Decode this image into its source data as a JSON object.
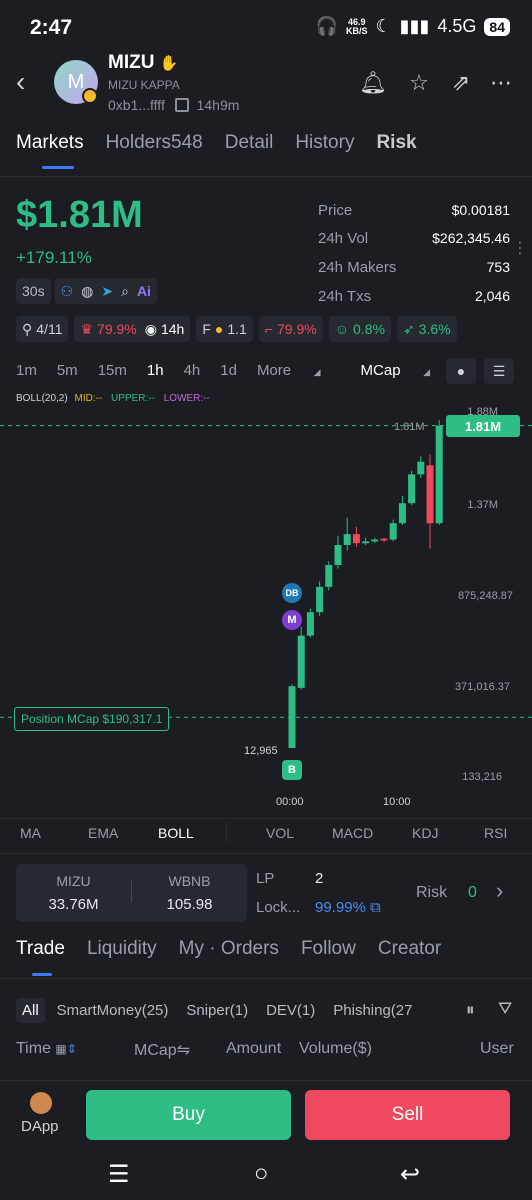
{
  "status_bar": {
    "time": "2:47",
    "net_speed_value": "46.9",
    "net_speed_unit": "KB/S",
    "signal": "4.5G",
    "battery": "84"
  },
  "token": {
    "avatar_letter": "M",
    "name": "MIZU",
    "fullname": "MIZU KAPPA",
    "address": "0xb1...ffff",
    "age": "14h9m"
  },
  "tabs": [
    "Markets",
    "Holders548",
    "Detail",
    "History",
    "Risk"
  ],
  "market": {
    "mcap": "$1.81M",
    "change": "+179.11%",
    "refresh": "30s",
    "stats": [
      {
        "label": "Price",
        "value": "$0.00181"
      },
      {
        "label": "24h Vol",
        "value": "$262,345.46"
      },
      {
        "label": "24h Makers",
        "value": "753"
      },
      {
        "label": "24h Txs",
        "value": "2,046"
      }
    ],
    "badges": {
      "holders_ratio": "4/11",
      "top10": "79.9%",
      "age": "14h",
      "f_label": "F",
      "f_value": "1.1",
      "sniper": "79.9%",
      "dev": "0.8%",
      "insider": "3.6%"
    }
  },
  "intervals": [
    "1m",
    "5m",
    "15m",
    "1h",
    "4h",
    "1d",
    "More",
    "MCap"
  ],
  "active_interval": "1h",
  "legend": {
    "boll": "BOLL(20,2)",
    "mid": "MID:--",
    "upper": "UPPER:--",
    "lower": "LOWER:--"
  },
  "chart_data": {
    "type": "candlestick",
    "y_axis_labels": [
      "1.88M",
      "1.37M",
      "875,248.87",
      "371,016.37",
      "133,216"
    ],
    "x_axis_labels": [
      "00:00",
      "10:00"
    ],
    "current_label": "1.81M",
    "current_tag": "1.81M",
    "low_label": "12,965",
    "position_label": "Position MCap $190,317.1",
    "markers": [
      "DB",
      "M",
      "B"
    ],
    "colors": {
      "up": "#2ebd85",
      "down": "#f0485e"
    },
    "candles": [
      {
        "open": 12965,
        "close": 370000,
        "low": 12965,
        "high": 380000
      },
      {
        "open": 360000,
        "close": 650000,
        "low": 350000,
        "high": 700000
      },
      {
        "open": 650000,
        "close": 780000,
        "low": 640000,
        "high": 800000
      },
      {
        "open": 780000,
        "close": 920000,
        "low": 760000,
        "high": 950000
      },
      {
        "open": 920000,
        "close": 1040000,
        "low": 900000,
        "high": 1060000
      },
      {
        "open": 1040000,
        "close": 1150000,
        "low": 1020000,
        "high": 1200000
      },
      {
        "open": 1150000,
        "close": 1210000,
        "low": 1120000,
        "high": 1300000
      },
      {
        "open": 1210000,
        "close": 1160000,
        "low": 1140000,
        "high": 1250000
      },
      {
        "open": 1160000,
        "close": 1170000,
        "low": 1150000,
        "high": 1190000
      },
      {
        "open": 1170000,
        "close": 1180000,
        "low": 1160000,
        "high": 1190000
      },
      {
        "open": 1185000,
        "close": 1175000,
        "low": 1165000,
        "high": 1190000
      },
      {
        "open": 1180000,
        "close": 1270000,
        "low": 1170000,
        "high": 1290000
      },
      {
        "open": 1270000,
        "close": 1380000,
        "low": 1260000,
        "high": 1420000
      },
      {
        "open": 1380000,
        "close": 1540000,
        "low": 1370000,
        "high": 1560000
      },
      {
        "open": 1540000,
        "close": 1610000,
        "low": 1520000,
        "high": 1640000
      },
      {
        "open": 1590000,
        "close": 1270000,
        "low": 1130000,
        "high": 1650000
      },
      {
        "open": 1270000,
        "close": 1810000,
        "low": 1260000,
        "high": 1840000
      }
    ]
  },
  "indicators": [
    "MA",
    "EMA",
    "BOLL",
    "VOL",
    "MACD",
    "KDJ",
    "RSI"
  ],
  "active_indicator": "BOLL",
  "pool": {
    "token_label": "MIZU",
    "token_value": "33.76M",
    "pair_label": "WBNB",
    "pair_value": "105.98",
    "lp_label": "LP",
    "lp_value": "2",
    "lock_label": "Lock...",
    "lock_value": "99.99%",
    "risk_label": "Risk",
    "risk_value": "0"
  },
  "bottom_tabs": [
    "Trade",
    "Liquidity",
    "My · Orders",
    "Follow",
    "Creator"
  ],
  "filters": [
    "All",
    "SmartMoney(25)",
    "Sniper(1)",
    "DEV(1)",
    "Phishing(27"
  ],
  "table_headers": {
    "time": "Time",
    "mcap": "MCap",
    "amount": "Amount",
    "volume": "Volume($)",
    "user": "User"
  },
  "footer": {
    "dapp": "DApp",
    "buy": "Buy",
    "sell": "Sell"
  }
}
